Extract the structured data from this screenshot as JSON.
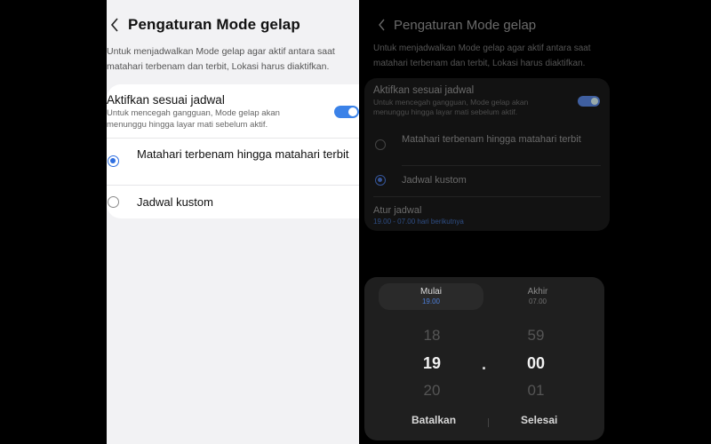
{
  "light": {
    "title": "Pengaturan Mode gelap",
    "description": "Untuk menjadwalkan Mode gelap agar aktif antara saat matahari terbenam dan terbit, Lokasi harus diaktifkan.",
    "schedule_toggle": {
      "label": "Aktifkan sesuai jadwal",
      "sublabel": "Untuk mencegah gangguan, Mode gelap akan menunggu hingga layar mati sebelum aktif.",
      "on": true
    },
    "options": [
      {
        "label": "Matahari terbenam hingga matahari terbit",
        "selected": true
      },
      {
        "label": "Jadwal kustom",
        "selected": false
      }
    ]
  },
  "dark": {
    "title": "Pengaturan Mode gelap",
    "description": "Untuk menjadwalkan Mode gelap agar aktif antara saat matahari terbenam dan terbit, Lokasi harus diaktifkan.",
    "schedule_toggle": {
      "label": "Aktifkan sesuai jadwal",
      "sublabel": "Untuk mencegah gangguan, Mode gelap akan menunggu hingga layar mati sebelum aktif.",
      "on": true
    },
    "options": [
      {
        "label": "Matahari terbenam hingga matahari terbit",
        "selected": false
      },
      {
        "label": "Jadwal kustom",
        "selected": true
      }
    ],
    "set_schedule": {
      "label": "Atur jadwal",
      "value": "19.00 - 07.00 hari berikutnya"
    },
    "picker": {
      "tabs": [
        {
          "label": "Mulai",
          "value": "19.00",
          "active": true
        },
        {
          "label": "Akhir",
          "value": "07.00",
          "active": false
        }
      ],
      "hour": {
        "prev": "18",
        "current": "19",
        "next": "20"
      },
      "separator": ".",
      "minute": {
        "prev": "59",
        "current": "00",
        "next": "01"
      },
      "cancel_label": "Batalkan",
      "done_label": "Selesai"
    }
  },
  "colors": {
    "accent_light": "#2f6fe0",
    "accent_dark": "#35559a",
    "toggle_on": "#3b82e8"
  },
  "icons": {
    "back": "chevron-left-icon"
  }
}
